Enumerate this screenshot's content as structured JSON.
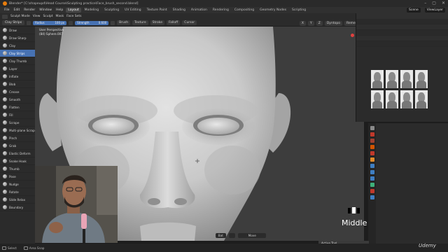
{
  "window": {
    "title": "Blender* [C:\\shapeupd\\Head Course\\Sculpting practice\\Face_brush_second.blend]",
    "controls": [
      "–",
      "▢",
      "✕"
    ]
  },
  "menubar": {
    "menus": [
      "File",
      "Edit",
      "Render",
      "Window",
      "Help"
    ],
    "tabs": [
      "Layout",
      "Modeling",
      "Sculpting",
      "UV Editing",
      "Texture Paint",
      "Shading",
      "Animation",
      "Rendering",
      "Compositing",
      "Geometry Nodes",
      "Scripting"
    ],
    "active_tab": "Layout",
    "scene": "Scene",
    "view_layer": "ViewLayer"
  },
  "header": {
    "mode": "Sculpt Mode",
    "menus": [
      "View",
      "Sculpt",
      "Mask",
      "Face Sets"
    ]
  },
  "tool_settings": {
    "tool": "Clay Strips",
    "radius_label": "Radius",
    "radius_value": "100 px",
    "strength_label": "Strength",
    "strength_value": "0.600",
    "dropdowns": [
      "Brush",
      "Texture",
      "Stroke",
      "Falloff",
      "Cursor"
    ],
    "right": [
      "X",
      "Y",
      "Z",
      "Dyntopo",
      "Remesh"
    ]
  },
  "toolbar": {
    "tools": [
      "Draw",
      "Draw Sharp",
      "Clay",
      "Clay Strips",
      "Clay Thumb",
      "Layer",
      "Inflate",
      "Blob",
      "Crease",
      "Smooth",
      "Flatten",
      "Fill",
      "Scrape",
      "Multi-plane Scrape",
      "Pinch",
      "Grab",
      "Elastic Deform",
      "Snake Hook",
      "Thumb",
      "Pose",
      "Nudge",
      "Rotate",
      "Slide Relax",
      "Boundary"
    ],
    "active": "Clay Strips"
  },
  "viewport": {
    "perspective": "User Perspective",
    "object": "(84) Sphere.007",
    "overlay_text": "Middle",
    "footer": [
      "Bat",
      "Move"
    ]
  },
  "panels": {
    "active_tool": "Active Tool"
  },
  "statusbar": {
    "items": [
      "Select",
      "Area Snap"
    ]
  },
  "watermark": "Udemy",
  "colors": {
    "accent_blue": "#4772b3",
    "bg_dark": "#1d1d1d",
    "panel": "#2b2b2b",
    "blender_orange": "#e87d0d"
  }
}
